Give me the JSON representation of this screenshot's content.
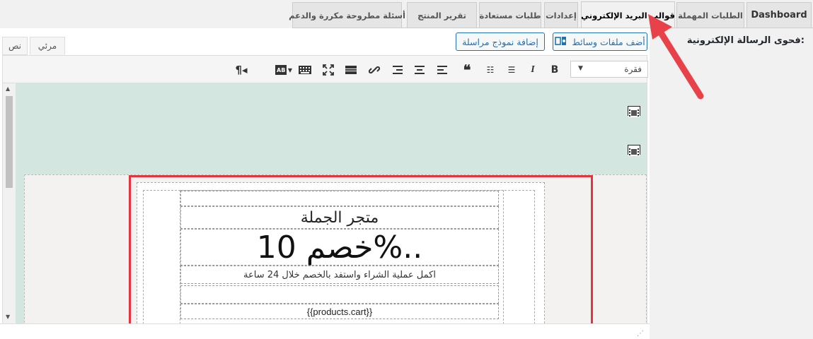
{
  "tabs": [
    {
      "label": "Dashboard"
    },
    {
      "label": "الطلبات المهملة"
    },
    {
      "label": "قوالب البريد الإلكتروني"
    },
    {
      "label": "إعدادات"
    },
    {
      "label": "طلبات مستعادة"
    },
    {
      "label": "تقرير المنتج"
    },
    {
      "label": "أسئلة مطروحة مكررة والدعم"
    }
  ],
  "field_label": "فحوى الرسالة الإلكترونية:",
  "editor": {
    "mode_tabs": {
      "text": "نص",
      "visual": "مرئي"
    },
    "add_media": "أضف ملفات وسائط",
    "add_template": "إضافة نموذج مراسلة",
    "format_select": "فقرة"
  },
  "email": {
    "store_name": "متجر الجملة",
    "discount": "خصم 10%..",
    "subtitle": "اكمل عملية الشراء واستفد بالخصم خلال 24 ساعة",
    "cart_tag": "{{products.cart}}"
  },
  "colors": {
    "editor_background": "#d4e6e0",
    "highlight": "#e5333f",
    "arrow": "#e8414a",
    "primary": "#2271b1"
  }
}
